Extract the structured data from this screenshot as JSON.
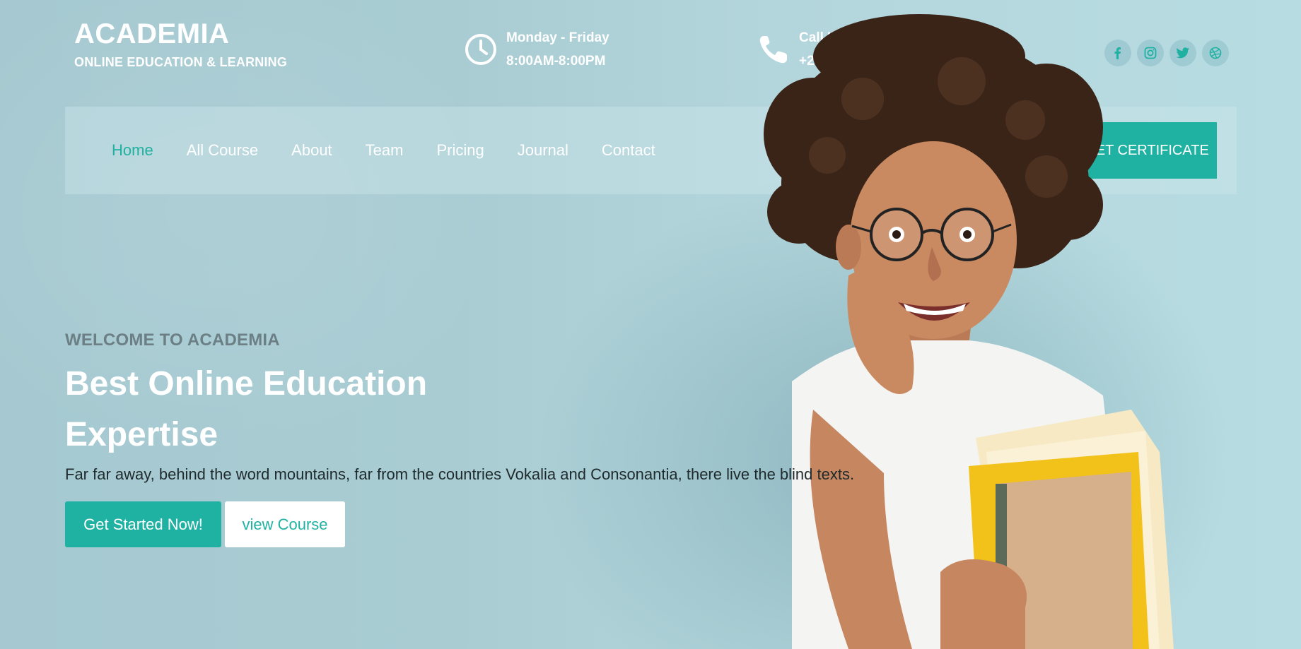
{
  "brand": {
    "name": "ACADEMIA",
    "tagline": "ONLINE EDUCATION & LEARNING"
  },
  "hours": {
    "icon": "clock-icon",
    "line1": "Monday - Friday",
    "line2": "8:00AM-8:00PM"
  },
  "call": {
    "icon": "phone-icon",
    "line1": "Call Us",
    "line2": "+2 392 3929 210"
  },
  "socials": [
    "facebook-icon",
    "instagram-icon",
    "twitter-icon",
    "dribbble-icon"
  ],
  "nav": {
    "items": [
      {
        "label": "Home",
        "active": true
      },
      {
        "label": "All Course"
      },
      {
        "label": "About"
      },
      {
        "label": "Team"
      },
      {
        "label": "Pricing"
      },
      {
        "label": "Journal"
      },
      {
        "label": "Contact"
      }
    ],
    "cta_label": "GET CERTIFICATE"
  },
  "hero": {
    "eyebrow": "WELCOME TO ACADEMIA",
    "title_line1": "Best Online Education",
    "title_line2": "Expertise",
    "text": "Far far away, behind the word mountains, far from the countries Vokalia and Consonantia, there live the blind texts.",
    "primary_button": "Get Started Now!",
    "secondary_button": "view Course"
  },
  "colors": {
    "accent": "#1fb2a2",
    "background": "#a9ccd3",
    "text_dark": "#1f2a2d",
    "eyebrow": "#6b7f85"
  }
}
